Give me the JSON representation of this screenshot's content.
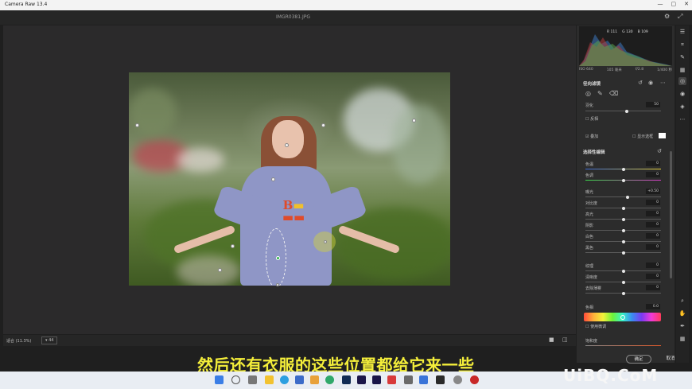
{
  "app": {
    "title": "Camera Raw 13.4",
    "filename": "IMGR0381.JPG"
  },
  "statusbar": {
    "zoom": "适合 (11.3%)",
    "extra": "▾ 44"
  },
  "histogram": {
    "readout": [
      "R 111",
      "G 130",
      "B 109"
    ],
    "info": [
      "ISO 640",
      "105 毫米",
      "f/2.8",
      "1/400 秒"
    ]
  },
  "mask": {
    "title": "径向滤镜",
    "feather_label": "羽化",
    "feather_value": "50",
    "invert_label": "反相",
    "overlay_label": "叠加",
    "show_pins_label": "显示选框"
  },
  "edit": {
    "title": "选择性编辑",
    "sliders": [
      {
        "label": "色温",
        "value": "0",
        "pos": 0.5,
        "grad": "temp"
      },
      {
        "label": "色调",
        "value": "0",
        "pos": 0.5,
        "grad": "tint"
      },
      {
        "label": "曝光",
        "value": "+0.50",
        "pos": 0.56,
        "grad": "none"
      },
      {
        "label": "对比度",
        "value": "0",
        "pos": 0.5,
        "grad": "none"
      },
      {
        "label": "高光",
        "value": "0",
        "pos": 0.5,
        "grad": "none"
      },
      {
        "label": "阴影",
        "value": "0",
        "pos": 0.5,
        "grad": "none"
      },
      {
        "label": "白色",
        "value": "0",
        "pos": 0.5,
        "grad": "none"
      },
      {
        "label": "黑色",
        "value": "0",
        "pos": 0.5,
        "grad": "none"
      },
      {
        "label": "纹理",
        "value": "0",
        "pos": 0.5,
        "grad": "none"
      },
      {
        "label": "清晰度",
        "value": "0",
        "pos": 0.5,
        "grad": "none"
      },
      {
        "label": "去除薄雾",
        "value": "0",
        "pos": 0.5,
        "grad": "none"
      }
    ],
    "hue_label": "色相",
    "hue_value": "0.0",
    "fine_label": "使用微调",
    "saturation_label": "饱和度"
  },
  "buttons": {
    "ok": "确定",
    "cancel": "取消"
  },
  "subtitle": "然后还有衣服的这些位置都给它来一些",
  "watermark": "UiBQ.CoM",
  "colors": {
    "accent": "#2fb34a",
    "subtitle": "#f4ee3a"
  },
  "icons": [
    "search-icon",
    "hand-icon",
    "eyedropper-icon",
    "grid-icon",
    "brush-icon",
    "gear-icon",
    "expand-icon",
    "undo-icon",
    "eye-icon",
    "trash-icon"
  ]
}
